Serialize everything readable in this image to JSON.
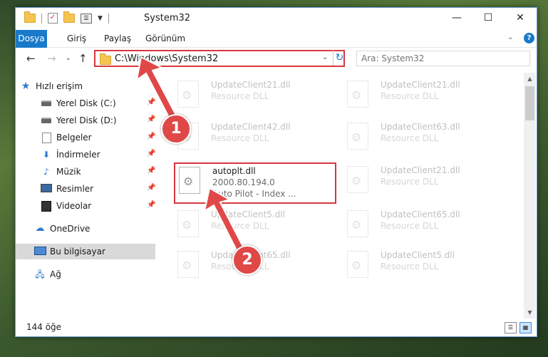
{
  "window": {
    "title": "System32",
    "controls": {
      "minimize": "—",
      "maximize": "☐",
      "close": "✕"
    }
  },
  "ribbon": {
    "tabs": [
      "Dosya",
      "Giriş",
      "Paylaş",
      "Görünüm"
    ],
    "help_label": "?"
  },
  "nav": {
    "address": "C:\\Windows\\System32",
    "search_placeholder": "Ara: System32"
  },
  "sidebar": {
    "quick_access": "Hızlı erişim",
    "items": [
      {
        "label": "Yerel Disk (C:)",
        "icon": "drive-icon"
      },
      {
        "label": "Yerel Disk (D:)",
        "icon": "drive-icon"
      },
      {
        "label": "Belgeler",
        "icon": "documents-icon"
      },
      {
        "label": "İndirmeler",
        "icon": "downloads-icon"
      },
      {
        "label": "Müzik",
        "icon": "music-icon"
      },
      {
        "label": "Resimler",
        "icon": "pictures-icon"
      },
      {
        "label": "Videolar",
        "icon": "videos-icon"
      }
    ],
    "onedrive": "OneDrive",
    "this_pc": "Bu bilgisayar",
    "network": "Ağ"
  },
  "files": [
    {
      "name": "UpdateClient21.dll",
      "type": "Resource DLL"
    },
    {
      "name": "UpdateClient21.dll",
      "type": "Resource DLL"
    },
    {
      "name": "UpdateClient42.dll",
      "type": "Resource DLL"
    },
    {
      "name": "UpdateClient63.dll",
      "type": "Resource DLL"
    },
    {
      "name": "autoplt.dll",
      "version": "2000.80.194.0",
      "description": "Auto Pilot - Index ..."
    },
    {
      "name": "UpdateClient21.dll",
      "type": "Resource DLL"
    },
    {
      "name": "UpdateClient5.dll",
      "type": "Resource DLL"
    },
    {
      "name": "UpdateClient65.dll",
      "type": "Resource DLL"
    },
    {
      "name": "UpdateClient65.dll",
      "type": "Resource DLL"
    },
    {
      "name": "UpdateClient5.dll",
      "type": "Resource DLL"
    }
  ],
  "status": {
    "item_count": "144 öğe"
  },
  "annotations": {
    "step1": "1",
    "step2": "2",
    "color": "#e04848"
  }
}
